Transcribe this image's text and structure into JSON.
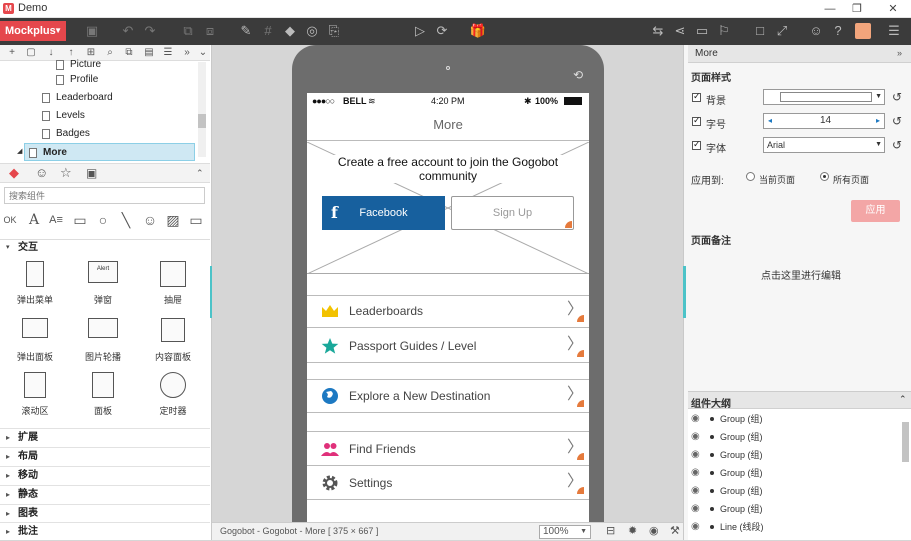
{
  "window": {
    "title": "Demo",
    "controls": [
      "—",
      "❐",
      "✕"
    ]
  },
  "toolbar": {
    "brand": "Mockplus"
  },
  "tree": {
    "items": [
      {
        "label": "Picture"
      },
      {
        "label": "Profile"
      },
      {
        "label": "Leaderboard"
      },
      {
        "label": "Levels"
      },
      {
        "label": "Badges"
      },
      {
        "label": "More"
      }
    ]
  },
  "components": {
    "search_placeholder": "搜索组件",
    "section": "交互",
    "items": [
      {
        "label": "弹出菜单"
      },
      {
        "label": "弹窗",
        "inner": "Alert"
      },
      {
        "label": "抽屉"
      },
      {
        "label": "弹出面板"
      },
      {
        "label": "图片轮播"
      },
      {
        "label": "内容面板"
      },
      {
        "label": "滚动区"
      },
      {
        "label": "面板"
      },
      {
        "label": "定时器"
      }
    ],
    "categories": [
      "扩展",
      "布局",
      "移动",
      "静态",
      "图表",
      "批注"
    ]
  },
  "phone": {
    "carrier": "BELL",
    "time": "4:20 PM",
    "battery": "100%",
    "nav_title": "More",
    "hero_text": "Create a free account to join the Gogobot community",
    "facebook_label": "Facebook",
    "facebook_glyph": "f",
    "signup_label": "Sign Up",
    "rows": [
      {
        "label": "Leaderboards",
        "icon": "crown-icon",
        "color": "#f2c200"
      },
      {
        "label": "Passport Guides / Level",
        "icon": "star-icon",
        "color": "#1aa89a"
      },
      {
        "label": "Explore a New Destination",
        "icon": "globe-icon",
        "color": "#1d79c2"
      },
      {
        "label": "Find Friends",
        "icon": "people-icon",
        "color": "#e0307a"
      },
      {
        "label": "Settings",
        "icon": "gear-icon",
        "color": "#555555"
      }
    ]
  },
  "statusbar": {
    "page_info": "Gogobot - Gogobot - More [ 375 × 667 ]",
    "zoom": "100%"
  },
  "properties": {
    "panel_title": "More",
    "page_style": "页面样式",
    "background_label": "背景",
    "font_size_label": "字号",
    "font_size_value": "14",
    "font_label": "字体",
    "font_value": "Arial",
    "apply_to_label": "应用到:",
    "apply_current": "当前页面",
    "apply_all": "所有页面",
    "apply_button": "应用",
    "notes_title": "页面备注",
    "notes_hint": "点击这里进行编辑",
    "outline_title": "组件大纲",
    "outline_items": [
      "Group (组)",
      "Group (组)",
      "Group (组)",
      "Group (组)",
      "Group (组)",
      "Group (组)",
      "Line (线段)"
    ]
  },
  "colors": {
    "accent": "#e5474c",
    "facebook": "#17609e",
    "toolbar": "#3b3b3b"
  }
}
